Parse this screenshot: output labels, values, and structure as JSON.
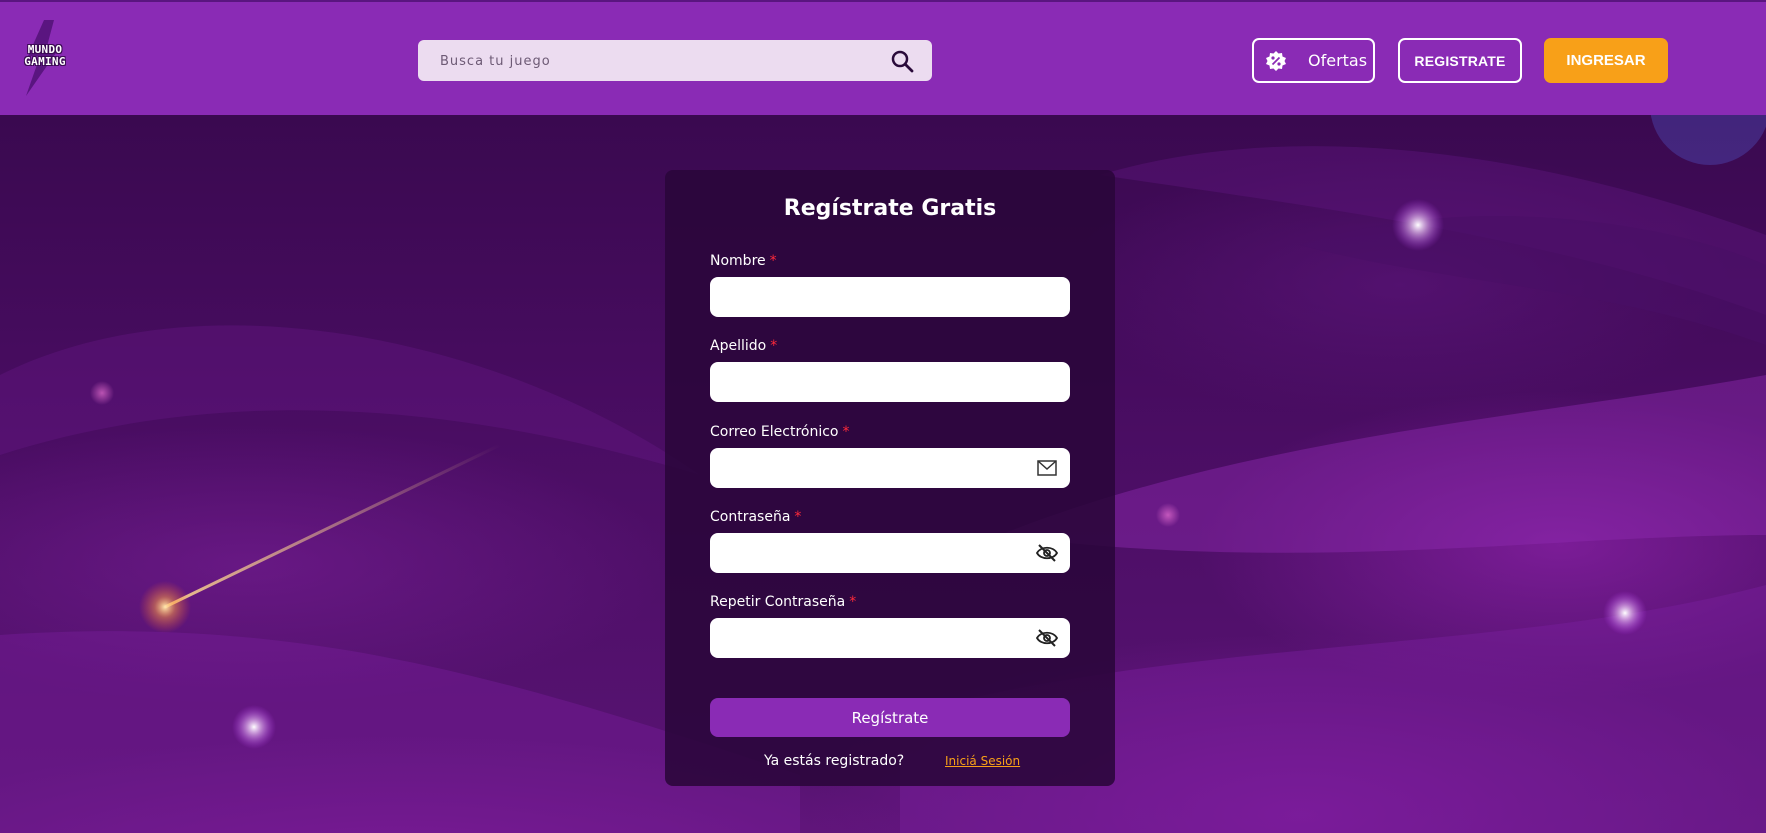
{
  "header": {
    "logo_lines": [
      "MUNDO",
      "GAMING"
    ],
    "search": {
      "placeholder": "Busca tu juego",
      "value": ""
    },
    "ofertas_label": "Ofertas",
    "registrate_label": "REGISTRATE",
    "ingresar_label": "INGRESAR"
  },
  "form": {
    "title": "Regístrate Gratis",
    "required_marker": "*",
    "fields": [
      {
        "label": "Nombre",
        "value": ""
      },
      {
        "label": "Apellido",
        "value": ""
      },
      {
        "label": "Correo Electrónico",
        "value": "",
        "icon": "mail-icon"
      },
      {
        "label": "Contraseña",
        "value": "",
        "icon": "eye-off-icon"
      },
      {
        "label": "Repetir Contraseña",
        "value": "",
        "icon": "eye-off-icon"
      }
    ],
    "submit_label": "Regístrate",
    "already_text": "Ya estás registrado?",
    "login_link": "Iniciá Sesión"
  },
  "colors": {
    "header_bg": "#8a2bb5",
    "accent_orange": "#f8a018",
    "required_red": "#ff2a3a",
    "page_bg": "#3a0a52"
  }
}
